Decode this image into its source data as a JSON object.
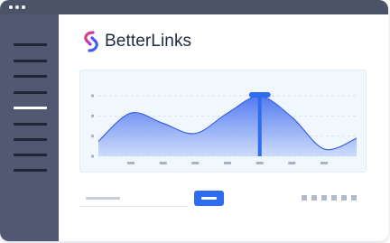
{
  "app": {
    "brand_name": "BetterLinks"
  },
  "icons": {
    "logo": "betterlinks-chain-logo-icon"
  },
  "sidebar": {
    "item_count": 9,
    "active_index": 4
  },
  "pagination": {
    "page_count": 6
  },
  "colors": {
    "titlebar": "#4b5367",
    "sidebar": "#505971",
    "accent": "#2f6cf0",
    "chart_fill_top": "#4b74ee",
    "chart_fill_bottom": "#c9d8fb",
    "chart_panel": "#f1f8fd",
    "brand_text": "#1f2a44"
  },
  "chart_data": {
    "type": "area",
    "x": [
      0,
      1,
      2,
      3,
      4,
      5,
      6,
      7,
      8
    ],
    "values": [
      0.25,
      0.72,
      0.55,
      0.38,
      0.72,
      1.0,
      0.65,
      0.12,
      0.3
    ],
    "ylim": [
      0,
      1.1
    ],
    "grid": true,
    "highlight_index": 5,
    "y_tick_count": 4,
    "x_tick_count": 7
  }
}
